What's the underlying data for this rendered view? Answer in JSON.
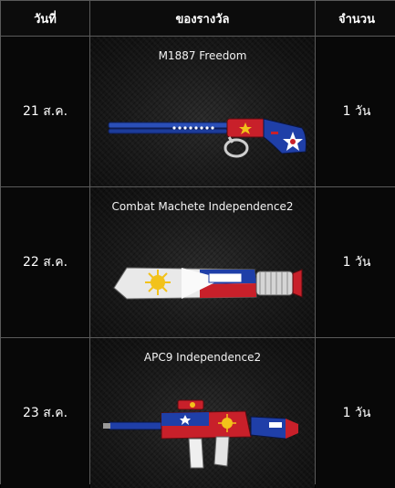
{
  "header": {
    "col_date": "วันที่",
    "col_prize": "ของรางวัล",
    "col_amount": "จำนวน"
  },
  "rows": [
    {
      "date": "21 ส.ค.",
      "prize": "M1887 Freedom",
      "amount": "1 วัน"
    },
    {
      "date": "22 ส.ค.",
      "prize": "Combat Machete Independence2",
      "amount": "1 วัน"
    },
    {
      "date": "23 ส.ค.",
      "prize": "APC9 Independence2",
      "amount": "1 วัน"
    }
  ],
  "colors": {
    "border": "#5a5a5a",
    "flag_blue": "#1f3fa8",
    "flag_red": "#c8202a",
    "flag_yellow": "#f2c21a"
  }
}
